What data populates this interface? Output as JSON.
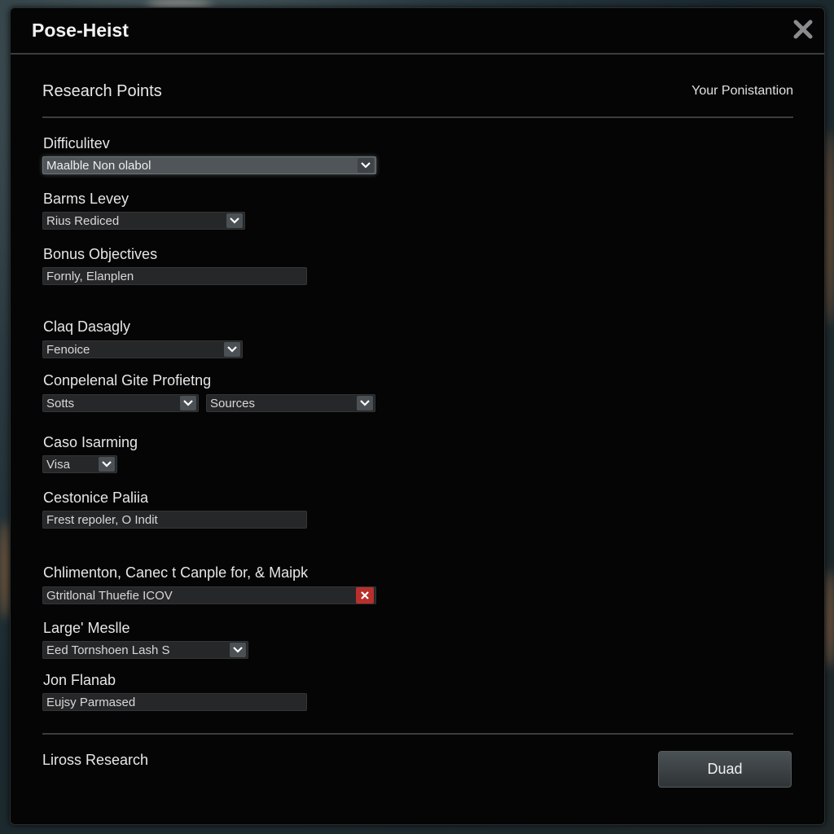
{
  "window": {
    "title": "Pose-Heist"
  },
  "header": {
    "section_title": "Research Points",
    "right_label": "Your Ponistantion"
  },
  "fields": [
    {
      "label": "Difficulitev",
      "value": "Maalble Non olabol",
      "type": "dropdown",
      "active": true
    },
    {
      "label": "Barms Levey",
      "value": "Rius Rediced",
      "type": "dropdown"
    },
    {
      "label": "Bonus Objectives",
      "value": "Fornly, Elanplen",
      "type": "text"
    },
    {
      "label": "Claq Dasagly",
      "value": "Fenoice",
      "type": "dropdown"
    },
    {
      "label": "Conpelenal Gite Profietng",
      "values": [
        "Sotts",
        "Sources"
      ],
      "type": "dropdown-pair"
    },
    {
      "label": "Caso Isarming",
      "value": "Visa",
      "type": "dropdown"
    },
    {
      "label": "Cestonice Paliia",
      "value": "Frest repoler, O Indit",
      "type": "text"
    },
    {
      "label": "Chlimenton, Canec t Canple for, & Maipk",
      "value": "Gtritlonal Thuefie ICOV",
      "type": "clearable"
    },
    {
      "label": "Large' Meslle",
      "value": "Eed Tornshoen Lash S",
      "type": "dropdown"
    },
    {
      "label": "Jon Flanab",
      "value": "Eujsy Parmased",
      "type": "text"
    }
  ],
  "footer": {
    "left_label": "Liross Research",
    "button_label": "Duad"
  },
  "colors": {
    "background": "#050505",
    "accent_clear": "#b8302c",
    "button": "#3d4346"
  }
}
